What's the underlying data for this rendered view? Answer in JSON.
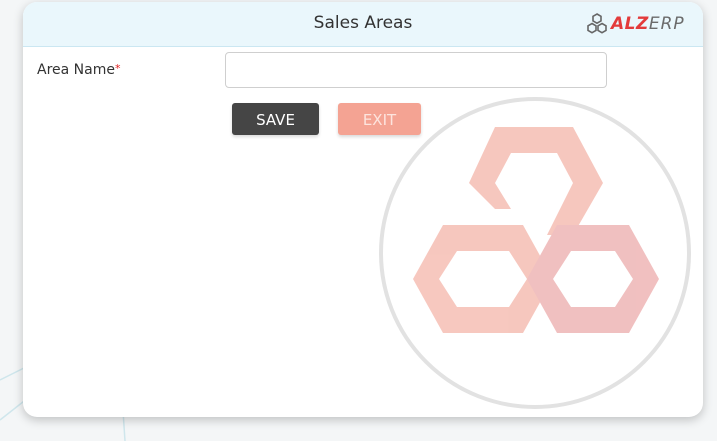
{
  "modal": {
    "title": "Sales Areas"
  },
  "logo": {
    "brand": "ALZ",
    "suffix": "ERP",
    "icon": "hexagon-triad-icon"
  },
  "form": {
    "area_name_label": "Area Name",
    "required_marker": "*",
    "area_name_value": "",
    "area_name_placeholder": ""
  },
  "buttons": {
    "save_label": "SAVE",
    "exit_label": "EXIT"
  },
  "colors": {
    "header_bg": "#eaf7fc",
    "save_bg": "#454545",
    "exit_bg": "#f4a393",
    "brand_red": "#e33b3b",
    "required": "#e02020"
  },
  "watermark": {
    "icon": "alzerp-hexagon-watermark-icon"
  }
}
